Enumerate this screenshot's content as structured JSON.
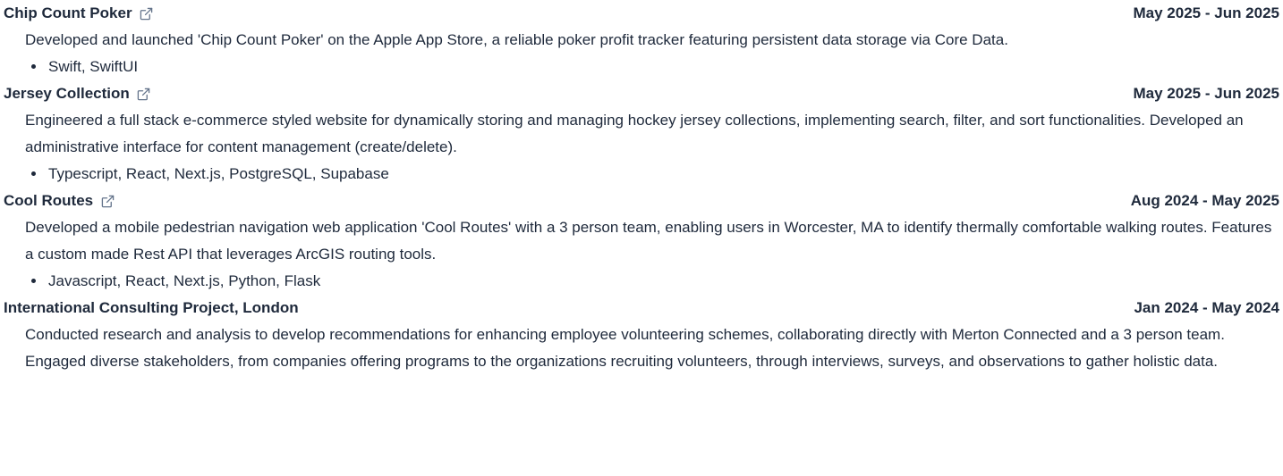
{
  "projects": [
    {
      "title": "Chip Count Poker",
      "link_icon": "external-link-icon",
      "date": "May 2025 - Jun 2025",
      "description": "Developed and launched 'Chip Count Poker' on the Apple App Store, a reliable poker profit tracker featuring persistent data storage via Core Data.",
      "tech": "Swift, SwiftUI"
    },
    {
      "title": "Jersey Collection",
      "link_icon": "external-link-icon",
      "date": "May 2025 - Jun 2025",
      "description": "Engineered a full stack e-commerce styled website for dynamically storing and managing hockey jersey collections, implementing search, filter, and sort functionalities. Developed an administrative interface for content management (create/delete).",
      "tech": "Typescript, React, Next.js, PostgreSQL, Supabase"
    },
    {
      "title": "Cool Routes",
      "link_icon": "external-link-icon",
      "date": "Aug 2024 - May 2025",
      "description": "Developed a mobile pedestrian navigation web application 'Cool Routes' with a 3 person team, enabling users in Worcester, MA to identify thermally comfortable walking routes. Features a custom made Rest API that leverages ArcGIS routing tools.",
      "tech": "Javascript, React, Next.js, Python, Flask"
    },
    {
      "title": "International Consulting Project, London",
      "date": "Jan 2024 - May 2024",
      "description": "Conducted research and analysis to develop recommendations for enhancing employee volunteering schemes, collaborating directly with Merton Connected and a 3 person team. Engaged diverse stakeholders, from companies offering programs to the organizations recruiting volunteers, through interviews, surveys, and observations to gather holistic data."
    }
  ],
  "colors": {
    "text": "#1e293b",
    "icon": "#64748b",
    "background": "#ffffff"
  }
}
